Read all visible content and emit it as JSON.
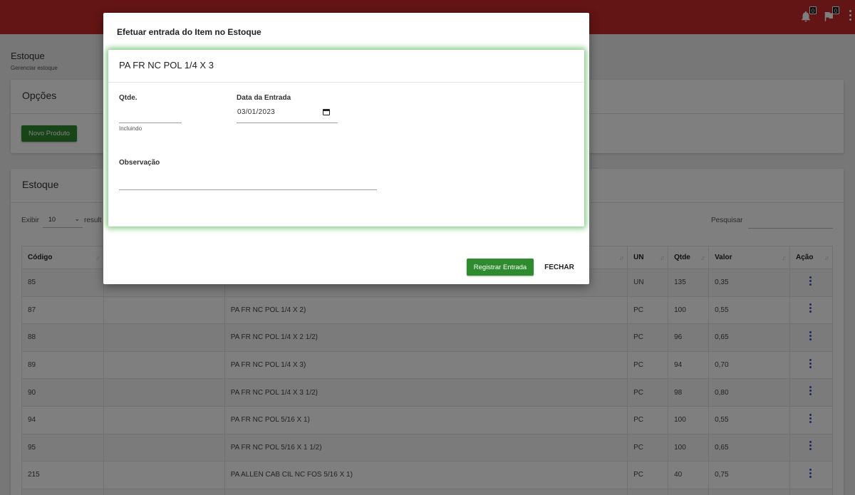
{
  "header": {
    "notif_count": "0",
    "flag_count": "0"
  },
  "page": {
    "title": "Estoque",
    "subtitle": "Gerenciar estoque"
  },
  "options_card": {
    "title": "Opções",
    "new_product_label": "Novo Produto"
  },
  "stock_card": {
    "title": "Estoque",
    "show_label": "Exibir",
    "page_size": "10",
    "results_label": "result",
    "search_label": "Pesquisar",
    "columns": [
      "Código",
      "",
      "",
      "UN",
      "Qtde",
      "Valor",
      "Ação"
    ],
    "rows": [
      {
        "code": "85",
        "desc": "",
        "un": "UN",
        "qty": "135",
        "value": "0,35"
      },
      {
        "code": "87",
        "desc": "PA FR NC POL 1/4 X 2)",
        "un": "PC",
        "qty": "100",
        "value": "0,55"
      },
      {
        "code": "88",
        "desc": "PA FR NC POL 1/4 X 2 1/2)",
        "un": "PC",
        "qty": "96",
        "value": "0,65"
      },
      {
        "code": "89",
        "desc": "PA FR NC POL 1/4 X 3)",
        "un": "PC",
        "qty": "94",
        "value": "0,70"
      },
      {
        "code": "90",
        "desc": "PA FR NC POL 1/4 X 3 1/2)",
        "un": "PC",
        "qty": "98",
        "value": "0,80"
      },
      {
        "code": "94",
        "desc": "PA FR NC POL 5/16 X 1)",
        "un": "PC",
        "qty": "100",
        "value": "0,55"
      },
      {
        "code": "95",
        "desc": "PA FR NC POL 5/16 X 1 1/2)",
        "un": "PC",
        "qty": "100",
        "value": "0,65"
      },
      {
        "code": "215",
        "desc": "PA ALLEN CAB CIL NC FOS 5/16 X 1)",
        "un": "PC",
        "qty": "40",
        "value": "0,75"
      },
      {
        "code": "",
        "desc": "",
        "un": "",
        "qty": "",
        "value": ""
      }
    ]
  },
  "modal": {
    "title": "Efetuar entrada do Item no Estoque",
    "item_name": "PA FR NC POL 1/4 X 3",
    "qty_label": "Qtde.",
    "qty_value": "",
    "qty_hint": "Incluindo",
    "date_label": "Data da Entrada",
    "date_value": "03/01/2023",
    "obs_label": "Observação",
    "obs_value": "",
    "register_label": "Registrar Entrada",
    "close_label": "FECHAR"
  },
  "colors": {
    "topbar": "#c62828",
    "accent_green": "#2e8b2e",
    "modal_glow": "#4caf50",
    "action_icon": "#3f51b5"
  },
  "icons": {
    "notifications": "bell-icon",
    "flags": "flag-icon",
    "menu": "more-vert-icon",
    "calendar": "calendar-icon",
    "row_action": "more-vert-icon",
    "sort": "sort-arrows-icon"
  }
}
